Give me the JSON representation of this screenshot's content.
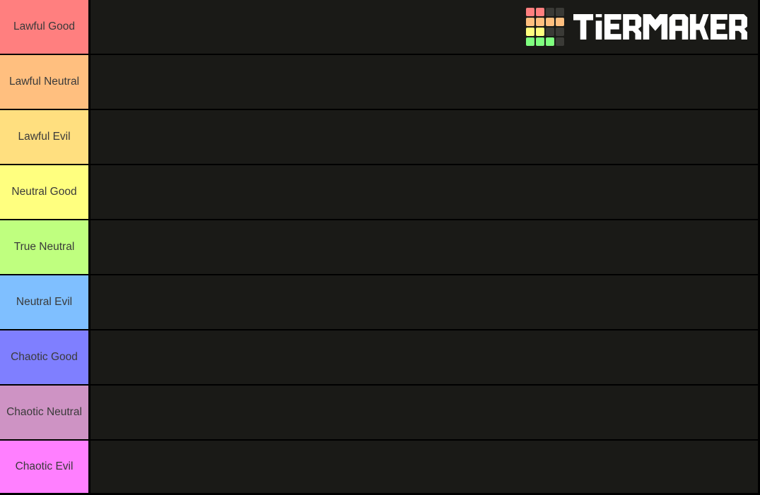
{
  "app": {
    "name": "TierMaker",
    "background_color": "#000000",
    "dropzone_color": "#1a1a17",
    "label_text_color": "#3a3a3a"
  },
  "logo": {
    "wordmark": "TIERMAKER",
    "wordmark_color": "#ffffff",
    "grid": {
      "rows": 4,
      "columns": 4,
      "cells": [
        "#ff7f7f",
        "#ff7f7f",
        "#3a3a36",
        "#3a3a36",
        "#ffbf7f",
        "#ffbf7f",
        "#ffbf7f",
        "#ffbf7f",
        "#ffff7f",
        "#ffff7f",
        "#3a3a36",
        "#3a3a36",
        "#7fff7f",
        "#7fff7f",
        "#7fff7f",
        "#3a3a36"
      ]
    }
  },
  "tiers": [
    {
      "label": "Lawful Good",
      "color": "#ff7f7f",
      "items": []
    },
    {
      "label": "Lawful Neutral",
      "color": "#ffbf7f",
      "items": []
    },
    {
      "label": "Lawful Evil",
      "color": "#ffdf7f",
      "items": []
    },
    {
      "label": "Neutral Good",
      "color": "#ffff7f",
      "items": []
    },
    {
      "label": "True Neutral",
      "color": "#bfff7f",
      "items": []
    },
    {
      "label": "Neutral Evil",
      "color": "#7fbfff",
      "items": []
    },
    {
      "label": "Chaotic Good",
      "color": "#7f7fff",
      "items": []
    },
    {
      "label": "Chaotic Neutral",
      "color": "#ce93c4",
      "items": []
    },
    {
      "label": "Chaotic Evil",
      "color": "#ff7fff",
      "items": []
    }
  ]
}
